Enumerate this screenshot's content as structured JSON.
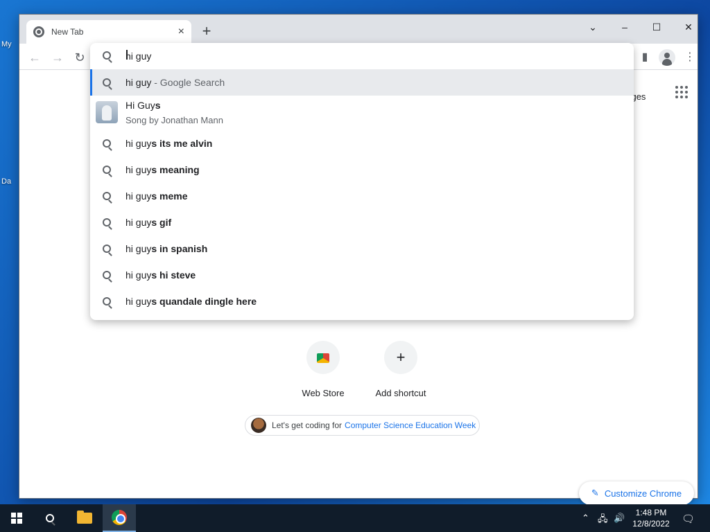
{
  "desktop": {
    "labels": [
      "My",
      "Da"
    ]
  },
  "browser": {
    "tab": {
      "title": "New Tab"
    },
    "window_controls": {
      "tabs_menu": "⌄",
      "minimize": "–",
      "maximize": "☐",
      "close": "✕"
    },
    "toolbar": {
      "back": "←",
      "forward": "→",
      "reload": "↻"
    }
  },
  "omnibox": {
    "value": "hi guy",
    "suggestions": [
      {
        "prefix": "hi guy",
        "suffix": "",
        "dim": " - Google Search",
        "type": "search"
      },
      {
        "type": "entity",
        "title_prefix": "Hi Guy",
        "title_bold": "s",
        "subtitle": "Song by Jonathan Mann"
      },
      {
        "prefix": "hi guy",
        "bold": "s its me alvin",
        "type": "search"
      },
      {
        "prefix": "hi guy",
        "bold": "s meaning",
        "type": "search"
      },
      {
        "prefix": "hi guy",
        "bold": "s meme",
        "type": "search"
      },
      {
        "prefix": "hi guy",
        "bold": "s gif",
        "type": "search"
      },
      {
        "prefix": "hi guy",
        "bold": "s in spanish",
        "type": "search"
      },
      {
        "prefix": "hi guy",
        "bold": "s hi steve",
        "type": "search"
      },
      {
        "prefix": "hi guy",
        "bold": "s quandale dingle here",
        "type": "search"
      }
    ]
  },
  "ntp": {
    "images_link": "nages",
    "shortcuts": [
      {
        "label": "Web Store"
      },
      {
        "label": "Add shortcut",
        "icon": "+"
      }
    ],
    "promo": {
      "text": "Let's get coding for",
      "link": "Computer Science Education Week"
    },
    "customize": {
      "icon": "✎",
      "label": "Customize Chrome"
    }
  },
  "taskbar": {
    "time": "1:48 PM",
    "date": "12/8/2022",
    "tray": {
      "chevron": "⌃",
      "network": "🖧",
      "volume": "🔊",
      "notifications": "🗨"
    }
  }
}
